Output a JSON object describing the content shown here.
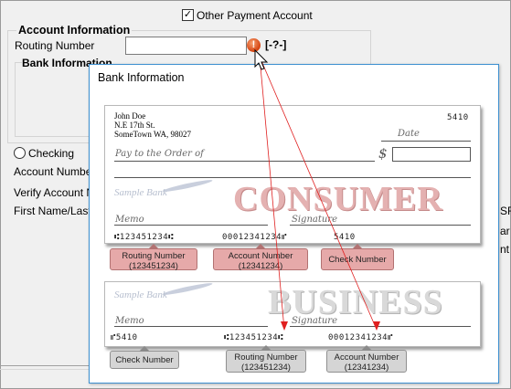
{
  "form": {
    "other_payment_label": "Other Payment Account",
    "account_info_title": "Account Information",
    "routing_number_label": "Routing Number",
    "routing_number_value": "",
    "bank_info_title": "Bank Information",
    "help_label": "[-?-]",
    "checking_label": "Checking",
    "account_number_label": "Account Number",
    "verify_account_label": "Verify Account Nu",
    "first_last_label": "First Name/Last N",
    "right_frag_1": "SF",
    "right_frag_2": "ar",
    "right_frag_3": "nt"
  },
  "popup": {
    "title": "Bank Information",
    "consumer_check": {
      "name": "John Doe",
      "address1": "N.E 17th St.",
      "address2": "SomeTown WA, 98027",
      "check_no": "5410",
      "date_label": "Date",
      "pay_label": "Pay to the Order of",
      "dollar": "$",
      "bank": "Sample Bank",
      "watermark": "CONSUMER",
      "memo_label": "Memo",
      "signature_label": "Signature",
      "micr_routing": "⑆123451234⑆",
      "micr_account": "00012341234⑈",
      "micr_check": "5410"
    },
    "business_check": {
      "bank": "Sample Bank",
      "watermark": "BUSINESS",
      "memo_label": "Memo",
      "signature_label": "Signature",
      "micr_check": "⑈5410",
      "micr_routing": "⑆123451234⑆",
      "micr_account": "00012341234⑈"
    },
    "consumer_tags": {
      "routing": "Routing Number",
      "routing_sub": "(123451234)",
      "account": "Account Number",
      "account_sub": "(12341234)",
      "check": "Check Number"
    },
    "business_tags": {
      "check": "Check Number",
      "routing": "Routing Number",
      "routing_sub": "(123451234)",
      "account": "Account Number",
      "account_sub": "(12341234)"
    }
  },
  "colors": {
    "error_icon": "#d4410e",
    "consumer_tag": "#e6a9a9",
    "business_tag": "#d5d5d5",
    "popup_border": "#3c8fd0",
    "arrow": "#e02020"
  }
}
